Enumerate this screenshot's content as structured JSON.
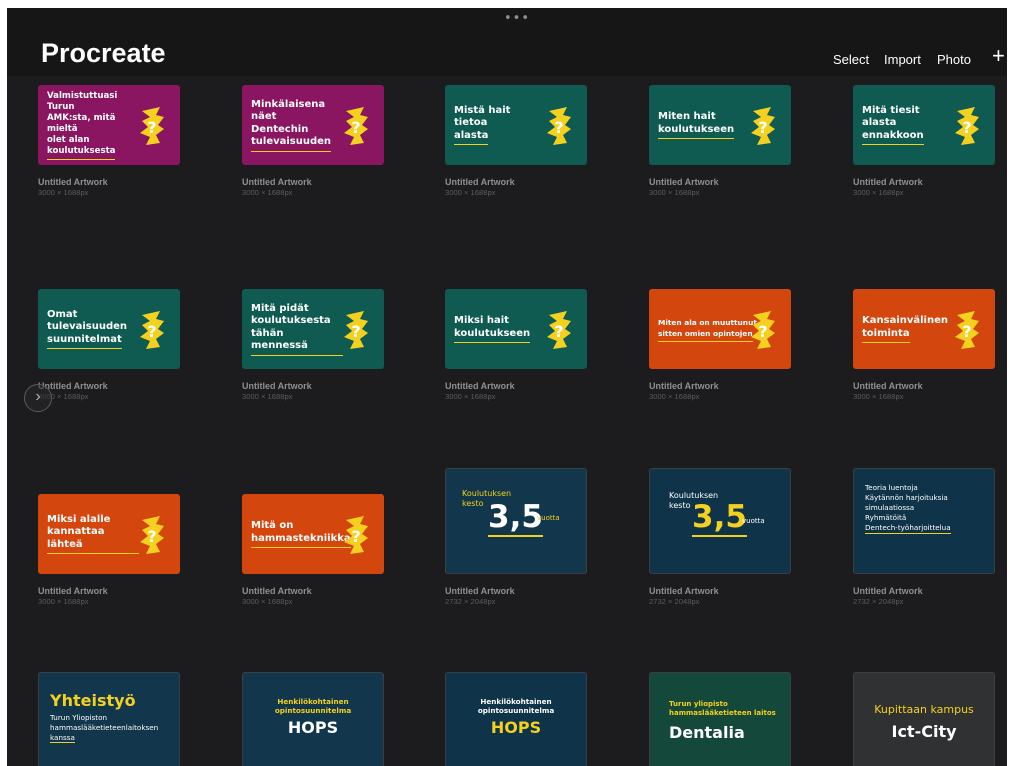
{
  "header": {
    "grabber": "•••",
    "title": "Procreate",
    "actions": {
      "select": "Select",
      "import": "Import",
      "photo": "Photo",
      "add": "+"
    }
  },
  "artworks": [
    {
      "title": "Untitled Artwork",
      "dims": "3000 × 1688px",
      "lines": [
        "Valmistuttuasi Turun",
        "AMK:sta, mitä mieltä",
        "olet alan",
        "koulutuksesta"
      ],
      "bg": "#8a1561"
    },
    {
      "title": "Untitled Artwork",
      "dims": "3000 × 1688px",
      "lines": [
        "Minkälaisena näet",
        "Dentechin",
        "tulevaisuuden"
      ],
      "bg": "#8a1561"
    },
    {
      "title": "Untitled Artwork",
      "dims": "3000 × 1688px",
      "lines": [
        "Mistä hait tietoa",
        "alasta"
      ],
      "bg": "#0f5b51"
    },
    {
      "title": "Untitled Artwork",
      "dims": "3000 × 1688px",
      "lines": [
        "Miten hait",
        "koulutukseen"
      ],
      "bg": "#0f5b51"
    },
    {
      "title": "Untitled Artwork",
      "dims": "3000 × 1688px",
      "lines": [
        "Mitä tiesit alasta",
        "ennakkoon"
      ],
      "bg": "#0f5b51"
    },
    {
      "title": "Untitled Artwork",
      "dims": "3000 × 1688px",
      "lines": [
        "Omat",
        "tulevaisuuden",
        "suunnitelmat"
      ],
      "bg": "#0f5b51"
    },
    {
      "title": "Untitled Artwork",
      "dims": "3000 × 1688px",
      "lines": [
        "Mitä pidät",
        "koulutuksesta",
        "tähän mennessä"
      ],
      "bg": "#0f5b51"
    },
    {
      "title": "Untitled Artwork",
      "dims": "3000 × 1688px",
      "lines": [
        "Miksi hait",
        "koulutukseen"
      ],
      "bg": "#0f5b51"
    },
    {
      "title": "Untitled Artwork",
      "dims": "3000 × 1688px",
      "lines": [
        "Miten ala on muuttunut",
        "sitten omien opintojen"
      ],
      "bg": "#d3470f"
    },
    {
      "title": "Untitled Artwork",
      "dims": "3000 × 1688px",
      "lines": [
        "Kansainvälinen",
        "toiminta"
      ],
      "bg": "#d3470f"
    },
    {
      "title": "Untitled Artwork",
      "dims": "3000 × 1688px",
      "lines": [
        "Miksi alalle",
        "kannattaa lähteä"
      ],
      "bg": "#d3470f"
    },
    {
      "title": "Untitled Artwork",
      "dims": "3000 × 1688px",
      "lines": [
        "Mitä on",
        "hammastekniikka"
      ],
      "bg": "#d3470f"
    },
    {
      "title": "Untitled Artwork",
      "dims": "2732 × 2048px",
      "label": [
        "Koulutuksen",
        "kesto"
      ],
      "big": "3,5",
      "unit": "vuotta"
    },
    {
      "title": "Untitled Artwork",
      "dims": "2732 × 2048px",
      "label": [
        "Koulutuksen",
        "kesto"
      ],
      "big": "3,5",
      "unit": "vuotta"
    },
    {
      "title": "Untitled Artwork",
      "dims": "2732 × 2048px",
      "lines": [
        "Teoria luentoja",
        "Käytännön harjoituksia",
        "simulaatiossa",
        "Ryhmätöitä",
        "Dentech-työharjoittelua"
      ]
    },
    {
      "big": "Yhteistyö",
      "lines": [
        "Turun Yliopiston",
        "hammaslääketieteenlaitoksen",
        "kanssa"
      ]
    },
    {
      "sub": [
        "Henkilökohtainen",
        "opintosuunnitelma"
      ],
      "big": "HOPS"
    },
    {
      "sub": [
        "Henkilökohtainen",
        "opintosuunnitelma"
      ],
      "big": "HOPS"
    },
    {
      "sub": [
        "Turun yliopisto",
        "hammaslääketieteen laitos"
      ],
      "big": "Dentalia"
    },
    {
      "sub": [
        "Kupittaan kampus"
      ],
      "big": "Ict-City"
    }
  ],
  "colors": {
    "accent_yellow": "#f4d11f",
    "magenta": "#8a1561",
    "teal": "#0f5b51",
    "orange": "#d3470f",
    "navy": "#12364b"
  },
  "icons": {
    "badge": "question-mark-badge-icon",
    "side": "chevron-right-icon"
  }
}
